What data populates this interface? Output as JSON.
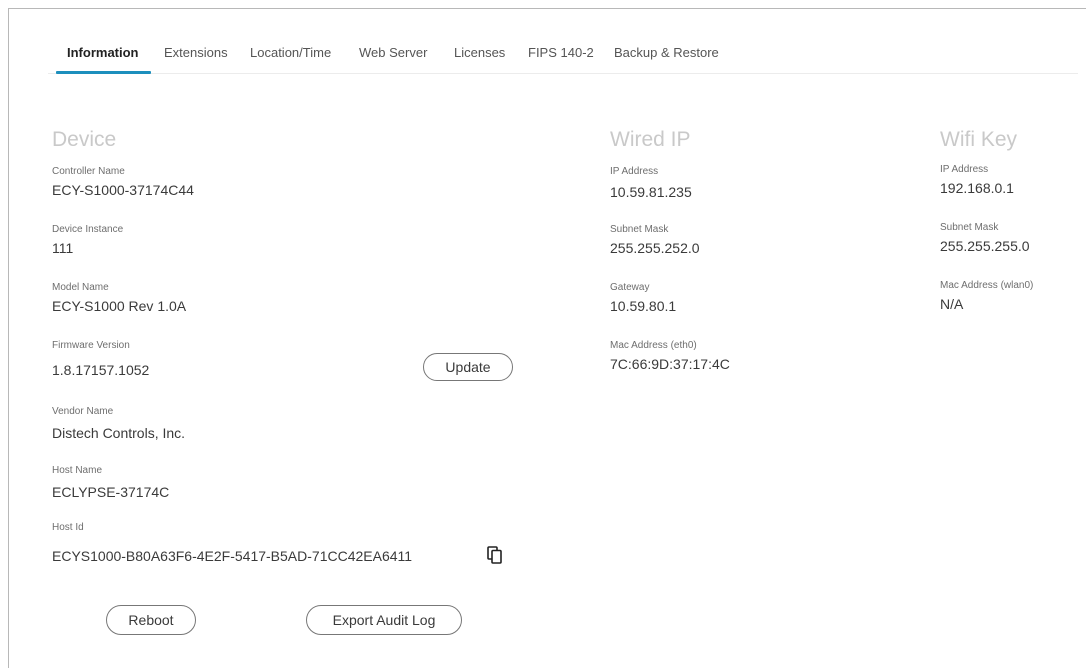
{
  "tabs": [
    {
      "label": "Information",
      "active": true
    },
    {
      "label": "Extensions"
    },
    {
      "label": "Location/Time"
    },
    {
      "label": "Web Server"
    },
    {
      "label": "Licenses"
    },
    {
      "label": "FIPS 140-2"
    },
    {
      "label": "Backup & Restore"
    }
  ],
  "device": {
    "title": "Device",
    "controller_name_label": "Controller Name",
    "controller_name": "ECY-S1000-37174C44",
    "device_instance_label": "Device Instance",
    "device_instance": "111",
    "model_name_label": "Model Name",
    "model_name": "ECY-S1000 Rev 1.0A",
    "firmware_version_label": "Firmware Version",
    "firmware_version": "1.8.17157.1052",
    "update_label": "Update",
    "vendor_name_label": "Vendor Name",
    "vendor_name": "Distech Controls, Inc.",
    "host_name_label": "Host Name",
    "host_name": "ECLYPSE-37174C",
    "host_id_label": "Host Id",
    "host_id": "ECYS1000-B80A63F6-4E2F-5417-B5AD-71CC42EA6411",
    "copy_icon": "copy-icon"
  },
  "wired_ip": {
    "title": "Wired IP",
    "ip_address_label": "IP Address",
    "ip_address": "10.59.81.235",
    "subnet_mask_label": "Subnet Mask",
    "subnet_mask": "255.255.252.0",
    "gateway_label": "Gateway",
    "gateway": "10.59.80.1",
    "mac_label": "Mac Address (eth0)",
    "mac": "7C:66:9D:37:17:4C"
  },
  "wifi_key": {
    "title": "Wifi Key",
    "ip_address_label": "IP Address",
    "ip_address": "192.168.0.1",
    "subnet_mask_label": "Subnet Mask",
    "subnet_mask": "255.255.255.0",
    "mac_label": "Mac Address (wlan0)",
    "mac": "N/A"
  },
  "actions": {
    "reboot_label": "Reboot",
    "export_audit_log_label": "Export Audit Log"
  },
  "colors": {
    "accent": "#1d8fbd",
    "section_title": "#c9c9c9",
    "text": "#3a3a3a"
  }
}
